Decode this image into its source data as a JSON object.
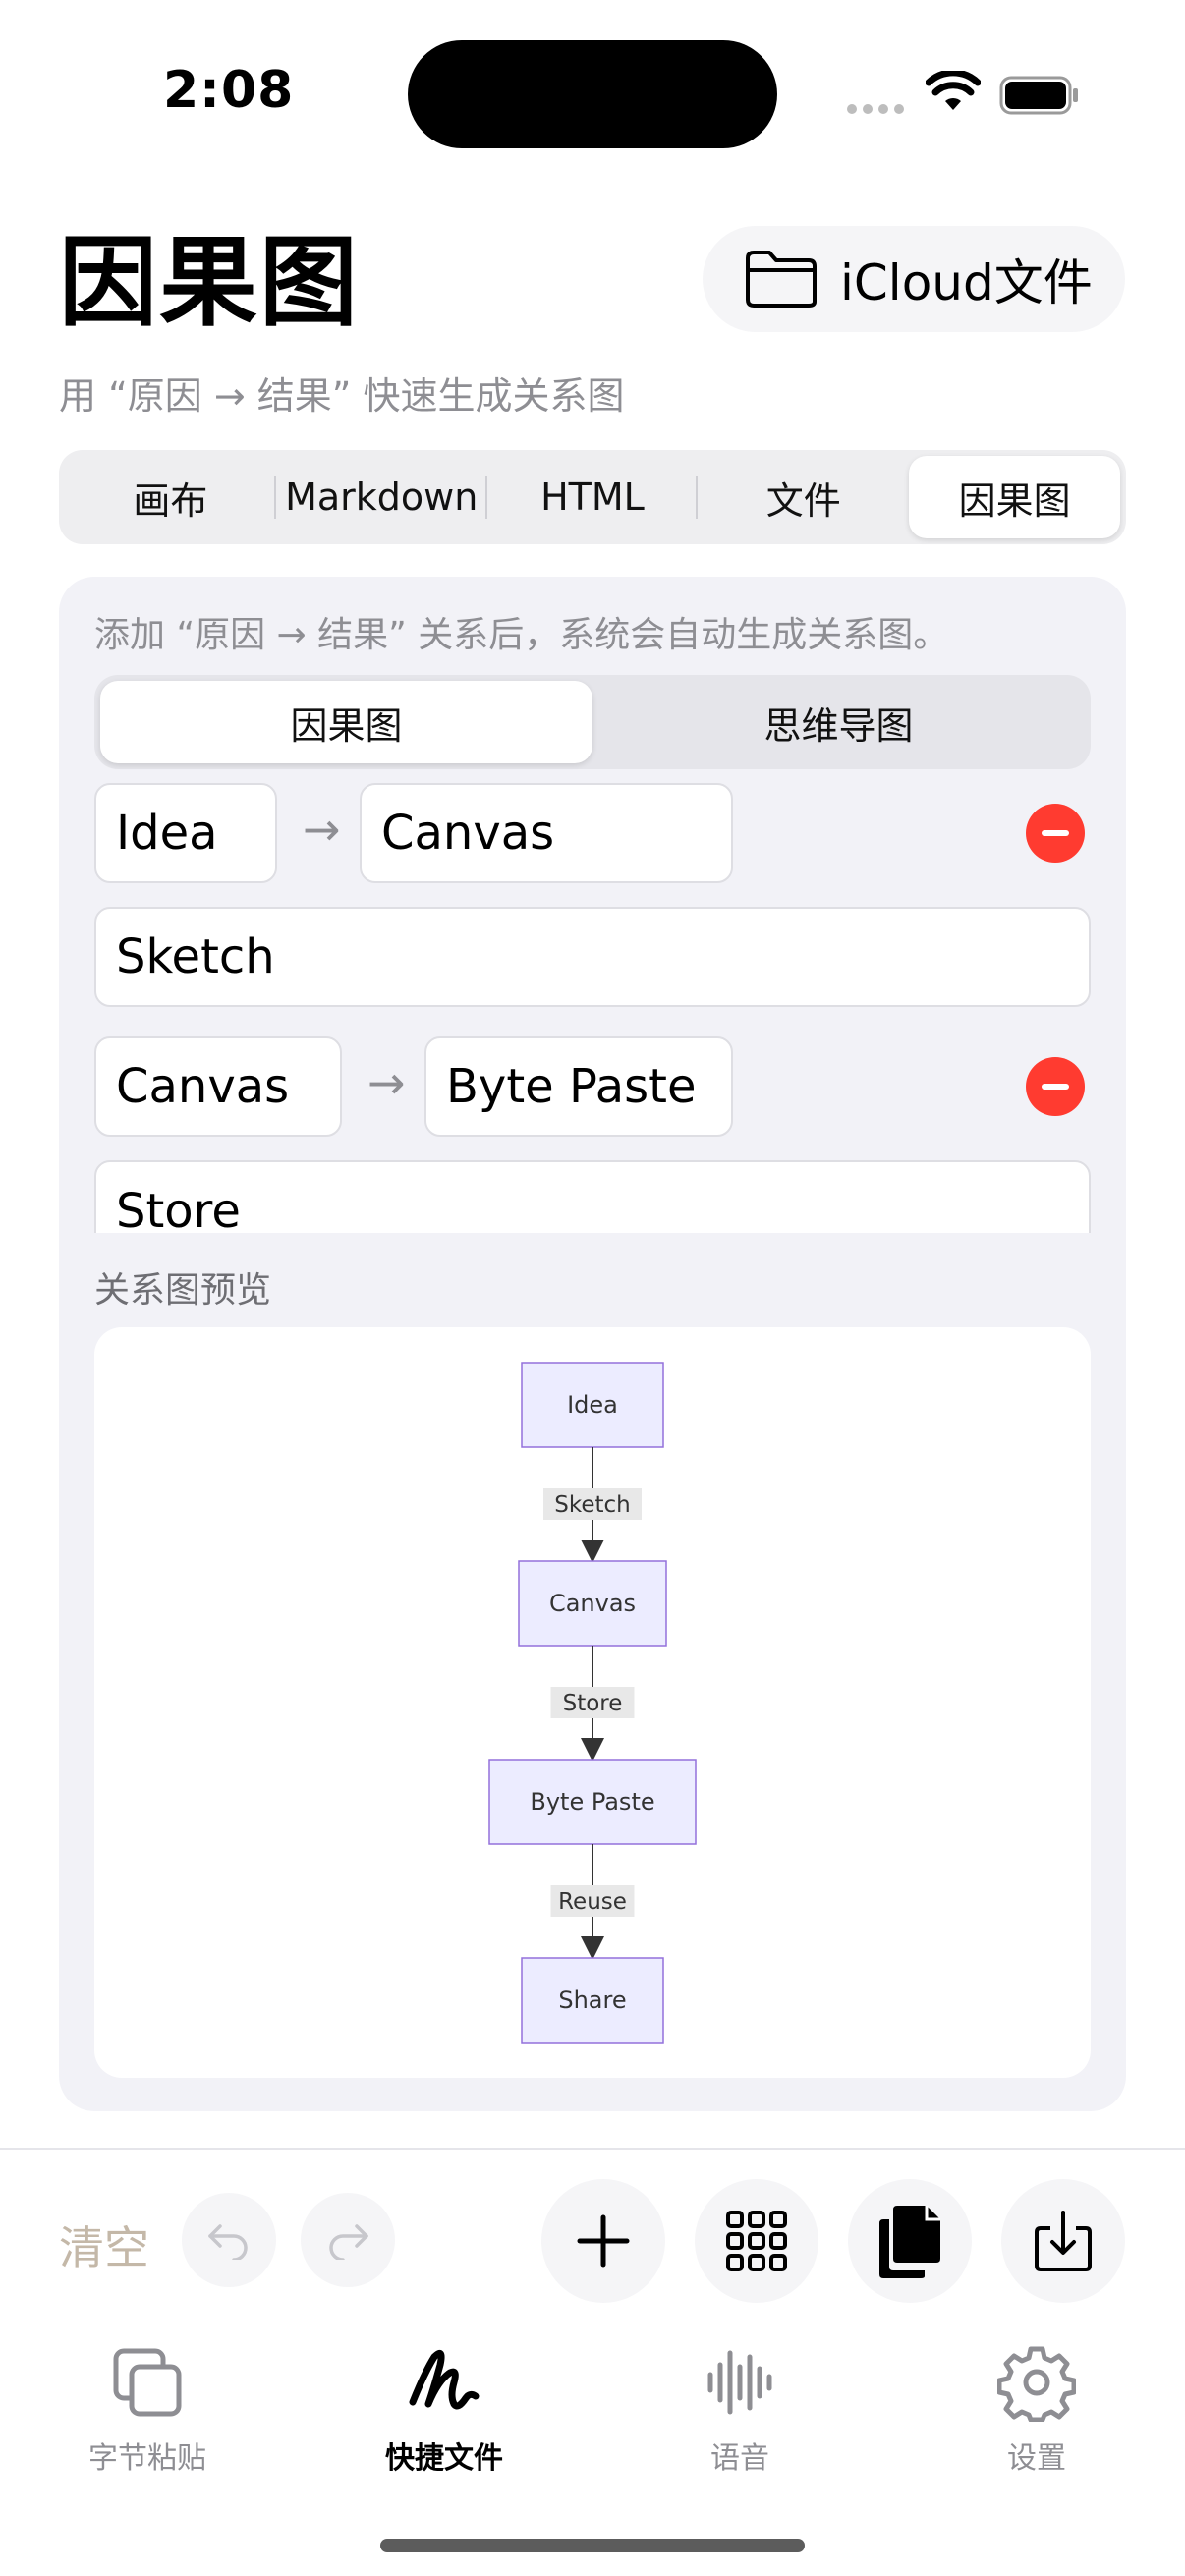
{
  "status_bar": {
    "time": "2:08"
  },
  "header": {
    "title": "因果图",
    "subtitle": "用 “原因 → 结果” 快速生成关系图",
    "icloud_label": "iCloud文件"
  },
  "tabs": [
    {
      "label": "画布",
      "active": false
    },
    {
      "label": "Markdown",
      "active": false
    },
    {
      "label": "HTML",
      "active": false
    },
    {
      "label": "文件",
      "active": false
    },
    {
      "label": "因果图",
      "active": true
    }
  ],
  "editor": {
    "hint": "添加 “原因 → 结果” 关系后，系统会自动生成关系图。",
    "modes": [
      {
        "label": "因果图",
        "active": true
      },
      {
        "label": "思维导图",
        "active": false
      }
    ],
    "relations": [
      {
        "cause": "Idea",
        "effect": "Canvas",
        "label": "Sketch"
      },
      {
        "cause": "Canvas",
        "effect": "Byte Paste",
        "label": "Store"
      }
    ],
    "preview_label": "关系图预览"
  },
  "diagram": {
    "nodes": [
      "Idea",
      "Canvas",
      "Byte Paste",
      "Share"
    ],
    "edge_labels": [
      "Sketch",
      "Store",
      "Reuse"
    ],
    "node_fill": "#ececff",
    "node_stroke": "#9370db"
  },
  "toolbar": {
    "clear_label": "清空",
    "icons": [
      "undo-icon",
      "redo-icon",
      "plus-icon",
      "grid-icon",
      "copy-icon",
      "download-icon"
    ]
  },
  "tab_bar": [
    {
      "label": "字节粘贴",
      "icon": "copy-squares-icon",
      "active": false
    },
    {
      "label": "快捷文件",
      "icon": "scribble-icon",
      "active": true
    },
    {
      "label": "语音",
      "icon": "waveform-icon",
      "active": false
    },
    {
      "label": "设置",
      "icon": "gear-icon",
      "active": false
    }
  ],
  "colors": {
    "accent_red": "#ff3b30",
    "card_bg": "#f2f2f7"
  }
}
